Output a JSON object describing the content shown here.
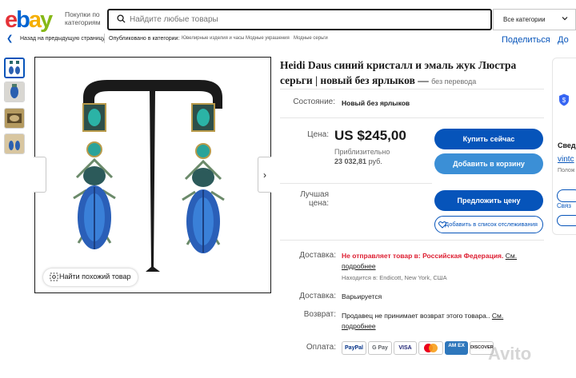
{
  "header": {
    "logo": {
      "e": "e",
      "b": "b",
      "a": "a",
      "y": "y"
    },
    "category_menu": "Покупки по категориям",
    "search_placeholder": "Найдите любые товары",
    "search_category": "Все категории"
  },
  "breadcrumb": {
    "back": "Назад на предыдущую страницу",
    "prefix": "Опубликовано в категории:",
    "items": [
      "Ювелирные изделия и часы",
      "Модные украшения",
      "Модные серьги"
    ]
  },
  "header_links": {
    "share": "Поделиться",
    "add": "До"
  },
  "gallery": {
    "similar_button": "Найти похожий товар"
  },
  "item": {
    "title": "Heidi Daus синий кристалл и эмаль жук Люстра серьги | новый без ярлыков —",
    "title_suffix": "без перевода",
    "condition_label": "Состояние:",
    "condition_value": "Новый без ярлыков",
    "price_label": "Цена:",
    "price": "US $245,00",
    "approx_label": "Приблизительно",
    "approx_value": "23 032,81",
    "approx_unit": "руб.",
    "offer_label": "Лучшая цена:"
  },
  "buttons": {
    "buy_now": "Купить сейчас",
    "add_to_cart": "Добавить в корзину",
    "make_offer": "Предложить цену",
    "watch": "Добавить в список отслеживания"
  },
  "details": {
    "shipping_label": "Доставка:",
    "shipping_red": "Не отправляет товар в: Российская Федерация.",
    "shipping_link1": "См.",
    "shipping_link2": "подробнее",
    "location": "Находится в: Endicott, New York, США",
    "delivery_label": "Доставка:",
    "delivery_value": "Варьируется",
    "returns_label": "Возврат:",
    "returns_value": "Продавец не принимает возврат этого товара..",
    "returns_link1": "См.",
    "returns_link2": "подробнее",
    "payment_label": "Оплата:",
    "payments": [
      "PayPal",
      "G Pay",
      "VISA",
      "MC",
      "AM EX",
      "DISCOVER"
    ]
  },
  "seller": {
    "head": "Свед",
    "name": "vintc",
    "positive": "Полож",
    "contact": "Связ"
  },
  "watermark": "Avito",
  "colors": {
    "accent": "#0654ba",
    "red": "#dd1e31",
    "cart": "#3b8fd6"
  }
}
